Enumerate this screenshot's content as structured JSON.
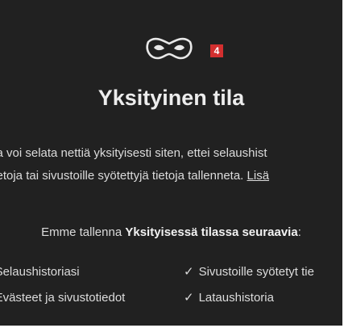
{
  "header": {
    "icon": "incognito-mask-icon",
    "badge": "4",
    "badge_color": "#d32f2f"
  },
  "title": "Yksityinen tila",
  "description": {
    "line1": "sa voi selata nettiä yksityisesti siten, ettei selaushist",
    "line2": "tietoja tai sivustoille syötettyjä tietoja tallenneta. ",
    "link": "Lisä"
  },
  "not_saved": {
    "intro_prefix": "Emme tallenna ",
    "intro_bold": "Yksityisessä tilassa seuraavia",
    "intro_suffix": ":",
    "check_glyph": "✓",
    "items": [
      "Selaushistoriasi",
      "Sivustoille syötetyt tie",
      "Evästeet ja sivustotiedot",
      "Lataushistoria"
    ]
  },
  "colors": {
    "background": "#212121",
    "text": "#e8e8e8",
    "badge": "#d32f2f"
  }
}
